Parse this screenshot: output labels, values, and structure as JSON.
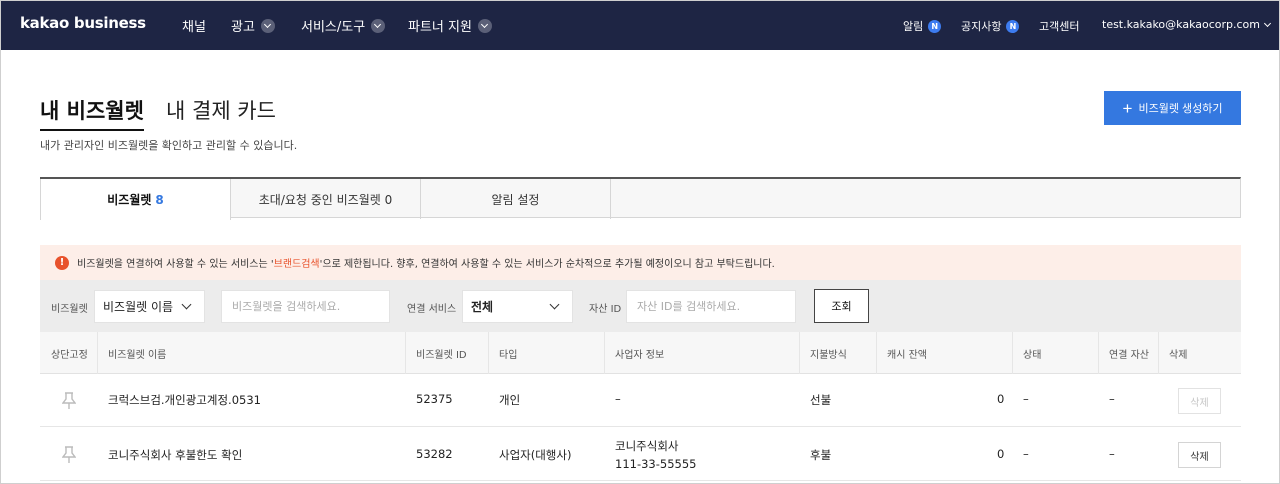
{
  "nav": {
    "logo": "kakao business",
    "menu": [
      {
        "label": "채널",
        "has_dropdown": false
      },
      {
        "label": "광고",
        "has_dropdown": true
      },
      {
        "label": "서비스/도구",
        "has_dropdown": true
      },
      {
        "label": "파트너 지원",
        "has_dropdown": true
      }
    ],
    "alerts_label": "알림",
    "notices_label": "공지사항",
    "new_badge": "N",
    "support_label": "고객센터",
    "account": "test.kakako@kakaocorp.com"
  },
  "page": {
    "title": "내 비즈월렛",
    "alt_title": "내 결제 카드",
    "description": "내가 관리자인 비즈월렛을 확인하고 관리할 수 있습니다.",
    "create_button": "비즈월렛 생성하기",
    "create_icon": "+"
  },
  "tabs": [
    {
      "label": "비즈월렛",
      "count": "8",
      "active": true
    },
    {
      "label": "초대/요청 중인 비즈월렛 0",
      "count": "",
      "active": false
    },
    {
      "label": "알림 설정",
      "count": "",
      "active": false
    }
  ],
  "notice": {
    "icon": "!",
    "text_before": "비즈월렛을 연결하여 사용할 수 있는 서비스는 '",
    "highlight": "브랜드검색",
    "text_after": "'으로 제한됩니다. 향후, 연결하여 사용할 수 있는 서비스가 순차적으로 추가될 예정이오니 참고 부탁드립니다.",
    "highlight_color": "#e8522c"
  },
  "filters": {
    "wallet_label": "비즈월렛",
    "wallet_select": "비즈월렛 이름",
    "wallet_placeholder": "비즈월렛을 검색하세요.",
    "service_label": "연결 서비스",
    "service_select": "전체",
    "asset_label": "자산 ID",
    "asset_placeholder": "자산 ID를 검색하세요.",
    "search_button": "조회"
  },
  "table": {
    "headers": [
      "상단고정",
      "비즈월렛 이름",
      "비즈월렛 ID",
      "타입",
      "사업자 정보",
      "지불방식",
      "캐시 잔액",
      "상태",
      "연결 자산",
      "삭제"
    ],
    "rows": [
      {
        "name": "크럭스브검.개인광고계정.0531",
        "id": "52375",
        "type": "개인",
        "biz_name": "–",
        "biz_no": "",
        "payment": "선불",
        "balance": "0",
        "status": "–",
        "asset": "–",
        "delete": "삭제",
        "delete_enabled": false
      },
      {
        "name": "코니주식회사 후불한도 확인",
        "id": "53282",
        "type": "사업자(대행사)",
        "biz_name": "코니주식회사",
        "biz_no": "111-33-55555",
        "payment": "후불",
        "balance": "0",
        "status": "–",
        "asset": "–",
        "delete": "삭제",
        "delete_enabled": true
      }
    ]
  },
  "colors": {
    "nav_bg": "#1e2544",
    "accent": "#3478e0",
    "warning": "#e8522c"
  }
}
